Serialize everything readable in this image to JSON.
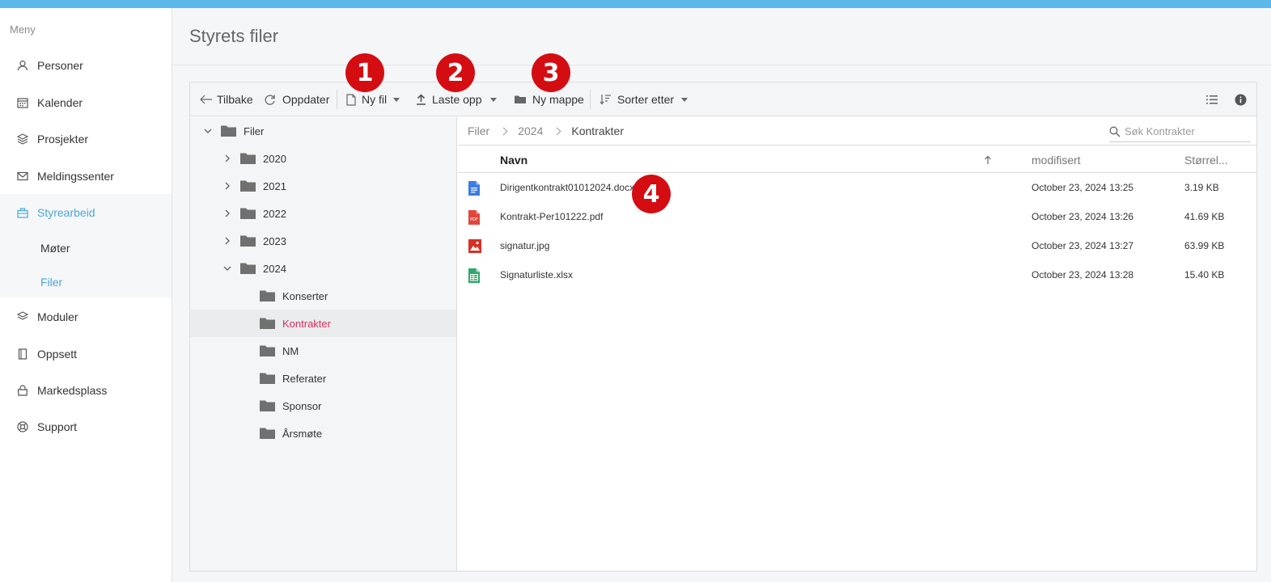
{
  "sidebar": {
    "menu_label": "Meny",
    "items": [
      {
        "label": "Personer",
        "icon": "person-icon"
      },
      {
        "label": "Kalender",
        "icon": "calendar-icon"
      },
      {
        "label": "Prosjekter",
        "icon": "layers-icon"
      },
      {
        "label": "Meldingssenter",
        "icon": "mail-icon"
      },
      {
        "label": "Styrearbeid",
        "icon": "briefcase-icon",
        "active": true
      },
      {
        "label": "Moduler",
        "icon": "modules-icon"
      },
      {
        "label": "Oppsett",
        "icon": "settings-icon"
      },
      {
        "label": "Markedsplass",
        "icon": "bag-icon"
      },
      {
        "label": "Support",
        "icon": "lifebuoy-icon"
      }
    ],
    "subitems": [
      {
        "label": "Møter"
      },
      {
        "label": "Filer",
        "active": true
      }
    ]
  },
  "page": {
    "title": "Styrets filer"
  },
  "toolbar": {
    "back": "Tilbake",
    "refresh": "Oppdater",
    "new_file": "Ny fil",
    "upload": "Laste opp",
    "new_folder": "Ny mappe",
    "sort": "Sorter etter"
  },
  "tree": {
    "root": "Filer",
    "folders": [
      "2020",
      "2021",
      "2022",
      "2023",
      "2024"
    ],
    "subfolders": [
      "Konserter",
      "Kontrakter",
      "NM",
      "Referater",
      "Sponsor",
      "Årsmøte"
    ],
    "selected": "Kontrakter"
  },
  "breadcrumb": [
    "Filer",
    "2024",
    "Kontrakter"
  ],
  "search": {
    "placeholder": "Søk Kontrakter"
  },
  "table": {
    "columns": {
      "name": "Navn",
      "modified": "modifisert",
      "size": "Størrel..."
    },
    "rows": [
      {
        "name": "Dirigentkontrakt01012024.docx",
        "modified": "October 23, 2024 13:25",
        "size": "3.19 KB",
        "type": "docx",
        "icon": "doc-file-icon"
      },
      {
        "name": "Kontrakt-Per101222.pdf",
        "modified": "October 23, 2024 13:26",
        "size": "41.69 KB",
        "type": "pdf",
        "icon": "pdf-file-icon",
        "icon_text": "PDF"
      },
      {
        "name": "signatur.jpg",
        "modified": "October 23, 2024 13:27",
        "size": "63.99 KB",
        "type": "jpg",
        "icon": "image-file-icon"
      },
      {
        "name": "Signaturliste.xlsx",
        "modified": "October 23, 2024 13:28",
        "size": "15.40 KB",
        "type": "xlsx",
        "icon": "sheet-file-icon"
      }
    ]
  },
  "badges": [
    "1",
    "2",
    "3",
    "4"
  ],
  "colors": {
    "accent": "#4aa8d8",
    "selected_text": "#d6325c",
    "badge": "#d40d12",
    "topbar": "#5bb8e8"
  }
}
